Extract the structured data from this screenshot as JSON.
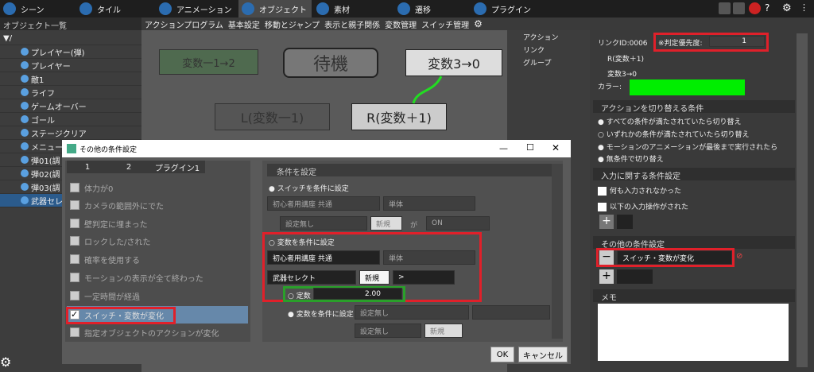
{
  "top_tabs": [
    "シーン",
    "タイル",
    "アニメーション",
    "オブジェクト",
    "素材",
    "遷移",
    "プラグイン"
  ],
  "object_list_title": "オブジェクト一覧",
  "objects": [
    "/",
    "プレイヤー(弾)",
    "プレイヤー",
    "敵1",
    "ライフ",
    "ゲームオーバー",
    "ゴール",
    "ステージクリア",
    "メニュー",
    "弾01(調",
    "弾02(調",
    "弾03(調",
    "武器セレ"
  ],
  "editor_tabs": [
    "アクションプログラム",
    "基本設定",
    "移動とジャンプ",
    "表示と親子関係",
    "変数管理",
    "スイッチ管理"
  ],
  "nodes": {
    "n1": "変数一1→2",
    "n2": "待機",
    "n3": "変数3→0",
    "n4": "L(変数一1)",
    "n5": "R(変数＋1)"
  },
  "link_panel": [
    "アクション",
    "リンク",
    "グループ"
  ],
  "right": {
    "link_id": "リンクID:0006",
    "priority_label": "※判定優先度:",
    "priority_value": "1",
    "link_from": "R(変数＋1)",
    "link_to": "変数3→0",
    "color_label": "カラー:",
    "color": "#00ee00",
    "sec1": "アクションを切り替える条件",
    "opts": [
      "すべての条件が満たされていたら切り替え",
      "いずれかの条件が満たされていたら切り替え",
      "モーションのアニメーションが最後まで実行されたら",
      "無条件で切り替え"
    ],
    "sec2": "入力に関する条件設定",
    "input1": "何も入力されなかった",
    "input2": "以下の入力操作がされた",
    "sec3": "その他の条件設定",
    "other_cond": "スイッチ・変数が変化",
    "sec4": "メモ"
  },
  "dialog": {
    "title": "その他の条件設定",
    "tabs": [
      "1",
      "2",
      "プラグイン1"
    ],
    "conds": [
      "体力が0",
      "カメラの範囲外にでた",
      "壁判定に埋まった",
      "ロックした/された",
      "確率を使用する",
      "モーションの表示が全て終わった",
      "一定時間が経過",
      "スイッチ・変数が変化",
      "指定オブジェクトのアクションが変化"
    ],
    "set_title": "条件を設定",
    "switch_radio": "スイッチを条件に設定",
    "sw_dd1": "初心者用講座 共通",
    "sw_dd2": "単体",
    "sw_dd3": "設定無し",
    "sw_new": "新規",
    "sw_ga": "が",
    "sw_on": "ON",
    "var_radio": "変数を条件に設定",
    "var_dd1": "初心者用講座 共通",
    "var_dd2": "単体",
    "var_sel": "武器セレクト",
    "var_new": "新規",
    "var_op": ">",
    "const_label": "定数",
    "const_value": "2.00",
    "var2_radio": "変数を条件に設定",
    "var2_dd": "設定無し",
    "var2_dd2": "設定無し",
    "var2_new": "新規",
    "ok": "OK",
    "cancel": "キャンセル"
  }
}
